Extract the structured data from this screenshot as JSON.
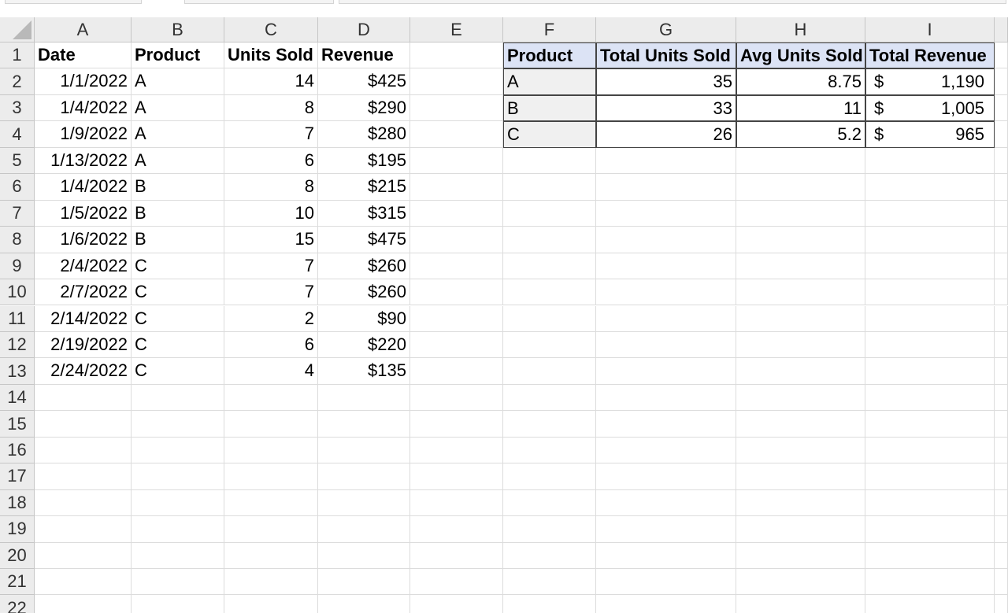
{
  "columns": [
    "A",
    "B",
    "C",
    "D",
    "E",
    "F",
    "G",
    "H",
    "I"
  ],
  "rows": [
    "1",
    "2",
    "3",
    "4",
    "5",
    "6",
    "7",
    "8",
    "9",
    "10",
    "11",
    "12",
    "13",
    "14",
    "15",
    "16",
    "17",
    "18",
    "19",
    "20",
    "21",
    "22"
  ],
  "sales_table": {
    "headers": [
      "Date",
      "Product",
      "Units Sold",
      "Revenue"
    ],
    "rows": [
      [
        "1/1/2022",
        "A",
        "14",
        "$425"
      ],
      [
        "1/4/2022",
        "A",
        "8",
        "$290"
      ],
      [
        "1/9/2022",
        "A",
        "7",
        "$280"
      ],
      [
        "1/13/2022",
        "A",
        "6",
        "$195"
      ],
      [
        "1/4/2022",
        "B",
        "8",
        "$215"
      ],
      [
        "1/5/2022",
        "B",
        "10",
        "$315"
      ],
      [
        "1/6/2022",
        "B",
        "15",
        "$475"
      ],
      [
        "2/4/2022",
        "C",
        "7",
        "$260"
      ],
      [
        "2/7/2022",
        "C",
        "7",
        "$260"
      ],
      [
        "2/14/2022",
        "C",
        "2",
        "$90"
      ],
      [
        "2/19/2022",
        "C",
        "6",
        "$220"
      ],
      [
        "2/24/2022",
        "C",
        "4",
        "$135"
      ]
    ]
  },
  "summary_table": {
    "headers": [
      "Product",
      "Total Units Sold",
      "Avg Units Sold",
      "Total Revenue"
    ],
    "rows": [
      {
        "product": "A",
        "total_units": "35",
        "avg_units": "8.75",
        "currency": "$",
        "total_revenue": "1,190"
      },
      {
        "product": "B",
        "total_units": "33",
        "avg_units": "11",
        "currency": "$",
        "total_revenue": "1,005"
      },
      {
        "product": "C",
        "total_units": "26",
        "avg_units": "5.2",
        "currency": "$",
        "total_revenue": "965"
      }
    ]
  },
  "colors": {
    "header_bg": "#ececec",
    "summary_header_bg": "#dce3f5",
    "gridline": "#dcdcdc"
  }
}
